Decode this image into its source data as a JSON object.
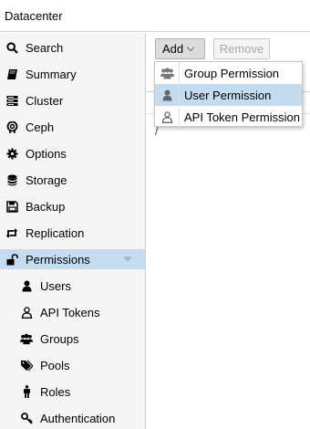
{
  "header": {
    "title": "Datacenter"
  },
  "sidebar": {
    "items": [
      {
        "label": "Search",
        "icon": "search-icon"
      },
      {
        "label": "Summary",
        "icon": "book-icon"
      },
      {
        "label": "Cluster",
        "icon": "server-icon"
      },
      {
        "label": "Ceph",
        "icon": "ceph-icon"
      },
      {
        "label": "Options",
        "icon": "gear-icon"
      },
      {
        "label": "Storage",
        "icon": "database-icon"
      },
      {
        "label": "Backup",
        "icon": "floppy-icon"
      },
      {
        "label": "Replication",
        "icon": "retweet-icon"
      },
      {
        "label": "Permissions",
        "icon": "unlock-icon",
        "selected": true
      },
      {
        "label": "Users",
        "icon": "user-icon"
      },
      {
        "label": "API Tokens",
        "icon": "user-outline-icon"
      },
      {
        "label": "Groups",
        "icon": "users-icon"
      },
      {
        "label": "Pools",
        "icon": "tags-icon"
      },
      {
        "label": "Roles",
        "icon": "male-icon"
      },
      {
        "label": "Authentication",
        "icon": "key-icon"
      }
    ]
  },
  "toolbar": {
    "add_label": "Add",
    "remove_label": "Remove"
  },
  "grid": {
    "row_text": "/"
  },
  "add_menu": {
    "items": [
      {
        "label": "Group Permission",
        "icon": "users-icon"
      },
      {
        "label": "User Permission",
        "icon": "user-icon",
        "highlighted": true
      },
      {
        "label": "API Token Permission",
        "icon": "user-outline-icon"
      }
    ]
  },
  "colors": {
    "selection": "#c4dcf0",
    "sidebar_bg": "#f5f5f5"
  }
}
